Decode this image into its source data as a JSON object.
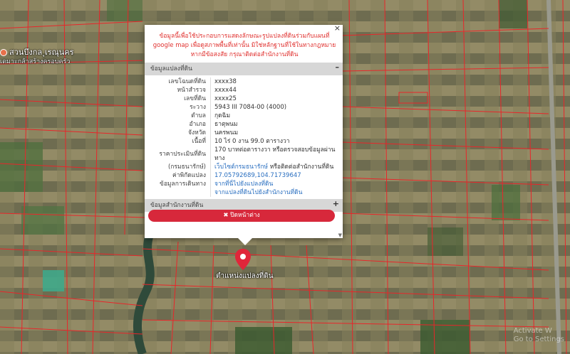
{
  "map": {
    "poi_name": "สวนบึงกล ุเรณุนคร",
    "poi_sub": "เดมาะกส้าสร้างครอบครัว",
    "marker_label": "ตำแหน่งแปลงที่ดิน",
    "watermark_line1": "Activate W",
    "watermark_line2": "Go to Settings"
  },
  "popup": {
    "close_symbol": "×",
    "notice": "ข้อมูลนี้เพื่อใช้ประกอบการแสดงลักษณะรูปแปลงที่ดินร่วมกับแผนที่ google map เพื่อดูสภาพพื้นที่เท่านั้น มิใช่หลักฐานที่ใช้ในทางกฎหมาย หากมีข้อสงสัย กรุณาติดต่อสำนักงานที่ดิน",
    "section1": {
      "title": "ข้อมูลแปลงที่ดิน",
      "toggle": "–"
    },
    "rows": [
      {
        "key": "เลขโฉนดที่ดิน",
        "value": "xxxx38"
      },
      {
        "key": "หน้าสำรวจ",
        "value": "xxxx44"
      },
      {
        "key": "เลขที่ดิน",
        "value": "xxxx25"
      },
      {
        "key": "ระวาง",
        "value": "5943 III 7084-00 (4000)"
      },
      {
        "key": "ตำบล",
        "value": "กุดฉิม"
      },
      {
        "key": "อำเภอ",
        "value": "ธาตุพนม"
      },
      {
        "key": "จังหวัด",
        "value": "นครพนม"
      },
      {
        "key": "เนื้อที่",
        "value": "10 ไร่ 0 งาน 99.0 ตารางวา"
      },
      {
        "key": "ราคาประเมินที่ดิน",
        "value": "170 บาทต่อตารางวา หรือตรวจสอบข้อมูลผ่านทาง"
      },
      {
        "key": "(กรมธนารักษ์)",
        "value_link": "เว็บไซต์กรมธนารักษ์",
        "value_rest": " หรือติดต่อสำนักงานที่ดิน"
      },
      {
        "key": "ค่าพิกัดแปลง",
        "value_link": "17.05792689,104.71739647"
      },
      {
        "key": "ข้อมูลการเดินทาง",
        "value_link": "จากที่นี่ไปยังแปลงที่ดิน"
      },
      {
        "key": "",
        "value_link": "จากแปลงที่ดินไปยังสำนักงานที่ดิน"
      }
    ],
    "section2": {
      "title": "ข้อมูลสำนักงานที่ดิน",
      "toggle": "+"
    },
    "close_button": "✖ ปิดหน้าต่าง",
    "scroll_arrow": "▼"
  },
  "colors": {
    "parcel_line": "#e8262a",
    "button": "#d7283b",
    "notice": "#e0312f",
    "link": "#2a6fc0"
  }
}
